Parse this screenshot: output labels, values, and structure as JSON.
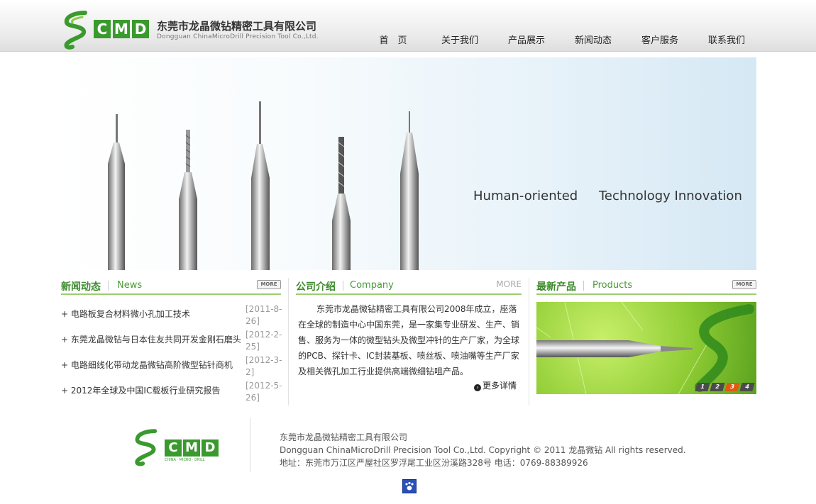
{
  "header": {
    "logo_letters": [
      "C",
      "M",
      "D"
    ],
    "company_cn": "东莞市龙晶微钻精密工具有限公司",
    "company_en": "Dongguan ChinaMicroDrill Precision Tool Co.,Ltd."
  },
  "nav": {
    "items": [
      "首　页",
      "关于我们",
      "产品展示",
      "新闻动态",
      "客户服务",
      "联系我们"
    ]
  },
  "banner": {
    "slogan_left": "Human-oriented",
    "slogan_right": "Technology Innovation"
  },
  "news": {
    "title_cn": "新闻动态",
    "title_en": "News",
    "more": "MORE",
    "items": [
      {
        "title": "+ 电路板复合材料微小孔加工技术",
        "date": "[2011-8-26]"
      },
      {
        "title": "+ 东莞龙晶微钻与日本住友共同开发金刚石磨头",
        "date": "[2012-2-25]"
      },
      {
        "title": "+ 电路细线化带动龙晶微钻高阶微型钻针商机",
        "date": "[2012-3-2]"
      },
      {
        "title": "+ 2012年全球及中国IC载板行业研究报告",
        "date": "[2012-5-26]"
      }
    ]
  },
  "company": {
    "title_cn": "公司介绍",
    "title_en": "Company",
    "more": "MORE",
    "intro": "东莞市龙晶微钻精密工具有限公司2008年成立，座落在全球的制造中心中国东莞，是一家集专业研发、生产、销售、服务为一体的微型钻头及微型冲针的生产厂家，为全球的PCB、探针卡、IC封装基板、喷丝板、喷油嘴等生产厂家及相关微孔加工行业提供高端微细钻咀产品。",
    "detail": "更多详情"
  },
  "products": {
    "title_cn": "最新产品",
    "title_en": "Products",
    "more": "MORE",
    "pages": [
      "1",
      "2",
      "3",
      "4"
    ],
    "active_page": "3"
  },
  "footer": {
    "logo_letters": [
      "C",
      "M",
      "D"
    ],
    "logo_tagline": "CHINA · MICRO · DRILL",
    "line1": "东莞市龙晶微钻精密工具有限公司",
    "line2": "Dongguan ChinaMicroDrill Precision Tool Co.,Ltd. Copyright © 2011 龙晶微钻 All rights reserved.",
    "line3": "地址：东莞市万江区严屋社区罗浮尾工业区汾溪路328号 电话：0769-88389926"
  },
  "colors": {
    "brand_green": "#3a9a2d",
    "accent_orange": "#e05a14"
  }
}
